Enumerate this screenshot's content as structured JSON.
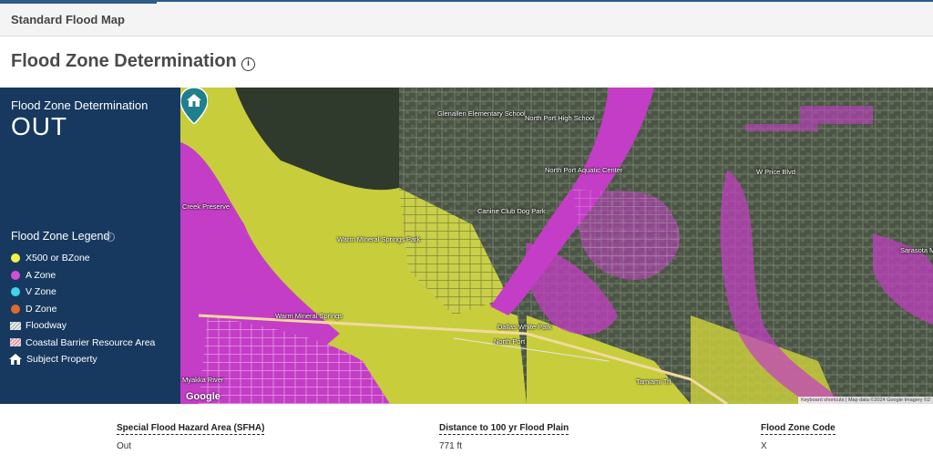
{
  "topbar": {
    "tab_label": "Standard Flood Map"
  },
  "page": {
    "title": "Flood Zone Determination",
    "info_icon": "info-icon"
  },
  "determination": {
    "label": "Flood Zone Determination",
    "value": "OUT"
  },
  "legend": {
    "title": "Flood Zone Legend",
    "items": [
      {
        "label": "X500 or BZone",
        "color": "#f2f24a",
        "icon": "dot"
      },
      {
        "label": "A Zone",
        "color": "#d24fd6",
        "icon": "dot"
      },
      {
        "label": "V Zone",
        "color": "#3fd5e6",
        "icon": "dot"
      },
      {
        "label": "D Zone",
        "color": "#e06a2c",
        "icon": "dot"
      },
      {
        "label": "Floodway",
        "color": "#d9d9d9",
        "icon": "hatch"
      },
      {
        "label": "Coastal Barrier Resource Area",
        "color": "#e9c7d0",
        "icon": "hatch-pink"
      },
      {
        "label": "Subject Property",
        "color": "#ffffff",
        "icon": "house-icon"
      }
    ]
  },
  "map": {
    "labels": {
      "glenallen": "Glenallen Elementary School",
      "northport_hs": "North Port High School",
      "aquatic": "North Port Aquatic Center",
      "canine": "Canine Club Dog Park",
      "warm_springs_park": "Warm Mineral Springs Park",
      "warm_springs": "Warm Mineral Springs",
      "dallas_white": "Dallas White Park",
      "north_port": "North Port",
      "price_blvd": "W Price Blvd",
      "sarasota": "Sarasota M Port EM",
      "myakka": "Myakka River",
      "creek": "Creek Preserve",
      "tamiami": "Tamiami Trl"
    },
    "google_logo": "Google",
    "attribution": "Keyboard shortcuts | Map data ©2024 Google Imagery ©2"
  },
  "summary": {
    "sfha": {
      "label": "Special Flood Hazard Area (SFHA)",
      "value": "Out"
    },
    "distance": {
      "label": "Distance to 100 yr Flood Plain",
      "value": "771 ft"
    },
    "zone_code": {
      "label": "Flood Zone Code",
      "value": "X"
    }
  }
}
